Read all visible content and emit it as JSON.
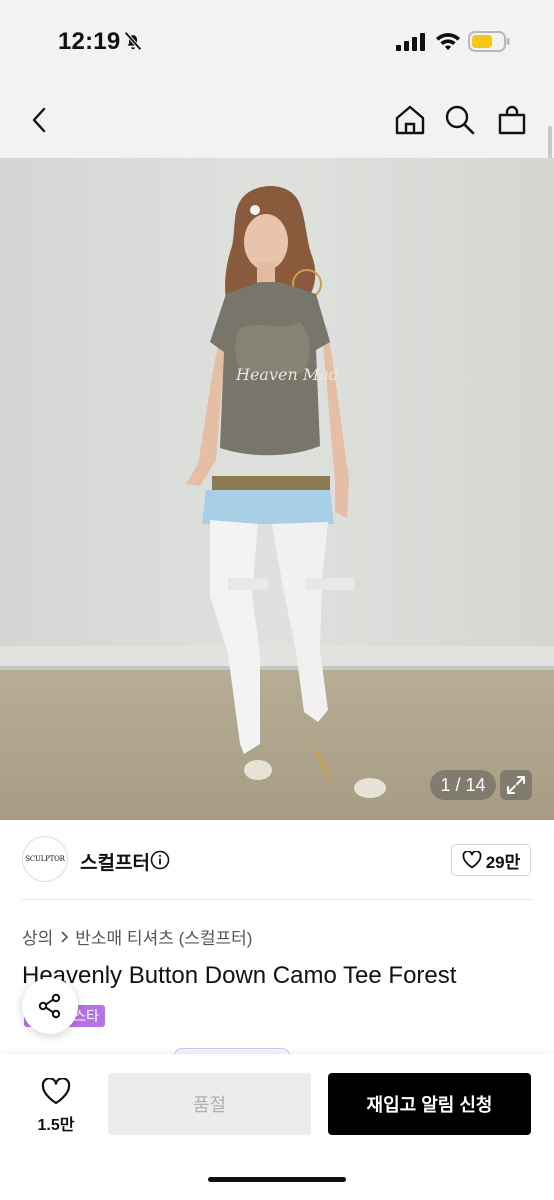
{
  "status_bar": {
    "time": "12:19",
    "icons": [
      "bell-slash-icon",
      "signal-icon",
      "wifi-icon",
      "battery-icon"
    ],
    "battery_color": "#f5c518"
  },
  "nav": {
    "icons": [
      "chevron-left-icon",
      "home-icon",
      "search-icon",
      "shopping-bag-icon"
    ]
  },
  "gallery": {
    "counter": "1 / 14",
    "expand_icon": "expand-icon"
  },
  "brand": {
    "logo_text": "SCULPTOR",
    "name": "스컬프터",
    "info_icon": "info-icon",
    "like_count": "29만"
  },
  "product": {
    "breadcrumb": [
      "상의",
      "반소매 티셔츠 (스컬프터)"
    ],
    "title": "Heavenly Button Down Camo Tee Forest",
    "badge": "스타",
    "badge_color": "#b872e8"
  },
  "bottom_bar": {
    "wish_count": "1.5만",
    "soldout_label": "품절",
    "restock_label": "재입고 알림 신청",
    "accent_color": "#000000"
  }
}
